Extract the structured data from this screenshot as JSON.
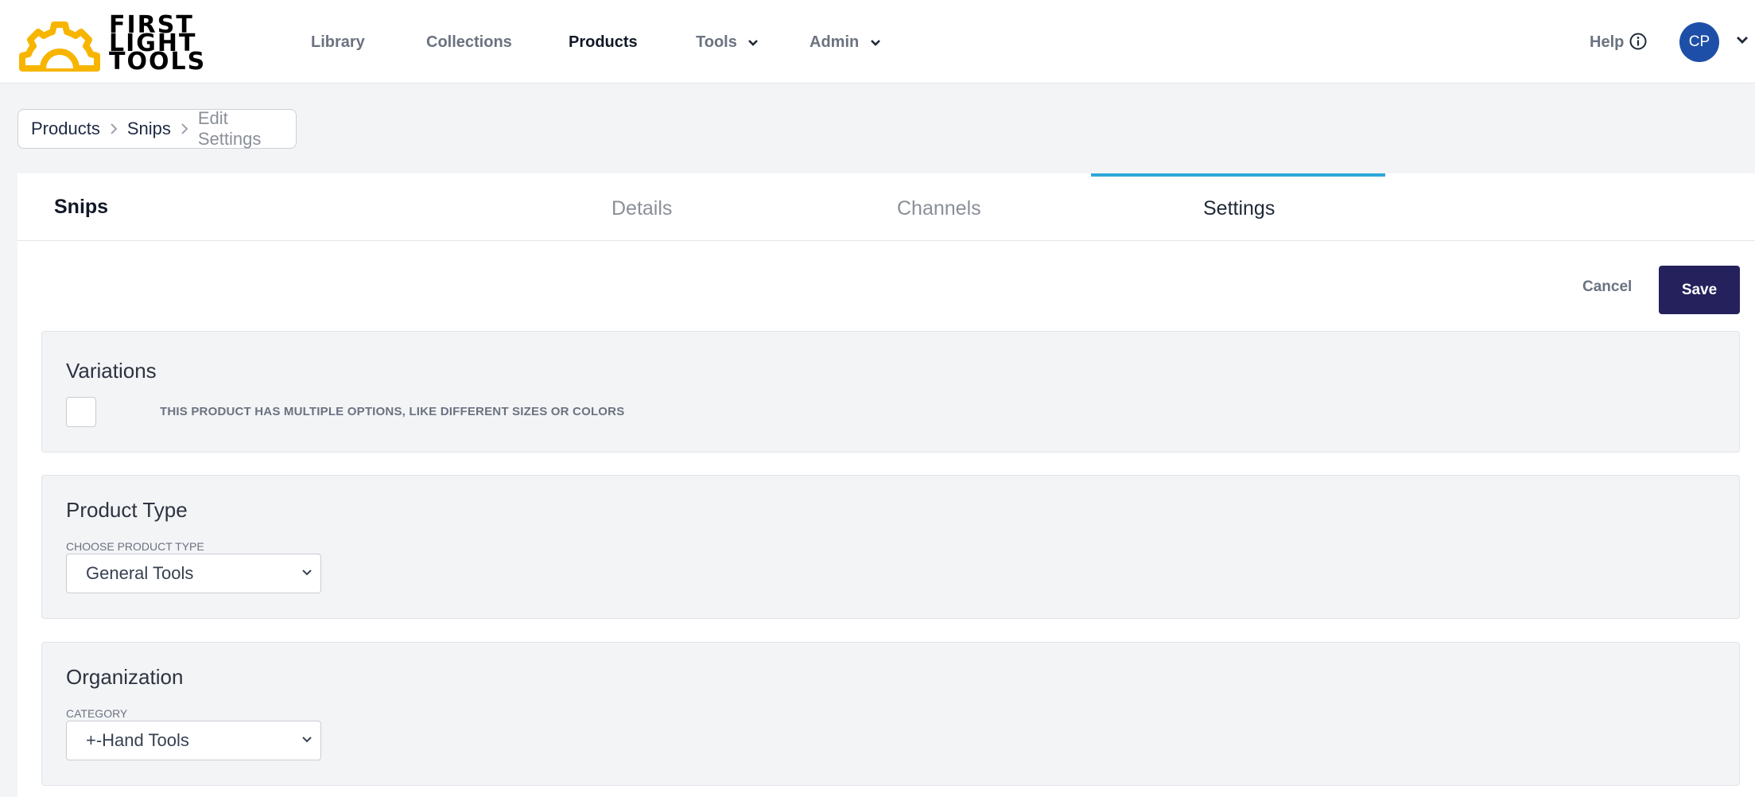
{
  "brand": {
    "line1": "FIRST",
    "line2": "LIGHT",
    "line3": "TOOLS",
    "color": "#f7b500"
  },
  "nav": {
    "library": "Library",
    "collections": "Collections",
    "products": "Products",
    "tools": "Tools",
    "admin": "Admin",
    "help": "Help",
    "user_initials": "CP"
  },
  "breadcrumb": {
    "items": [
      "Products",
      "Snips",
      "Edit Settings"
    ]
  },
  "product": {
    "title": "Snips",
    "tabs": [
      {
        "label": "Details",
        "active": false
      },
      {
        "label": "Channels",
        "active": false
      },
      {
        "label": "Settings",
        "active": true
      }
    ]
  },
  "actions": {
    "cancel": "Cancel",
    "save": "Save"
  },
  "variations": {
    "title": "Variations",
    "checkbox_label": "THIS PRODUCT HAS MULTIPLE OPTIONS, LIKE DIFFERENT SIZES OR COLORS",
    "checked": false
  },
  "product_type": {
    "title": "Product Type",
    "label": "CHOOSE PRODUCT TYPE",
    "value": "General Tools"
  },
  "organization": {
    "title": "Organization",
    "label": "CATEGORY",
    "value": "+-Hand Tools"
  },
  "colors": {
    "accent": "#2ca8db",
    "primary": "#24215c",
    "avatar": "#1e4fa8"
  }
}
